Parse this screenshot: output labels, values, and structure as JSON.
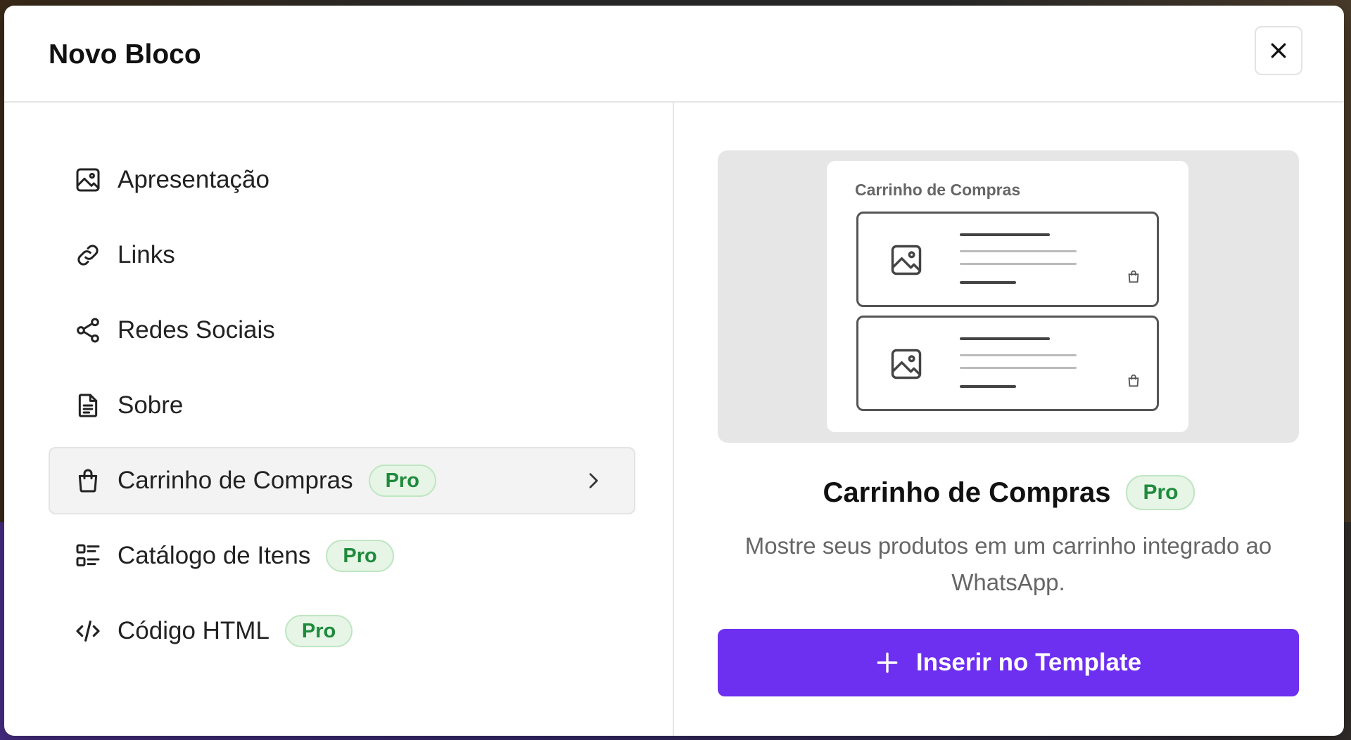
{
  "modal": {
    "title": "Novo Bloco"
  },
  "menu": {
    "items": [
      {
        "label": "Apresentação",
        "icon": "image-icon",
        "pro": false
      },
      {
        "label": "Links",
        "icon": "link-icon",
        "pro": false
      },
      {
        "label": "Redes Sociais",
        "icon": "share-icon",
        "pro": false
      },
      {
        "label": "Sobre",
        "icon": "document-icon",
        "pro": false
      },
      {
        "label": "Carrinho de Compras",
        "icon": "shopping-bag-icon",
        "pro": true,
        "active": true
      },
      {
        "label": "Catálogo de Itens",
        "icon": "catalog-list-icon",
        "pro": true
      },
      {
        "label": "Código HTML",
        "icon": "code-icon",
        "pro": true
      }
    ],
    "pro_label": "Pro"
  },
  "preview": {
    "card_title": "Carrinho de Compras",
    "title": "Carrinho de Compras",
    "pro_label": "Pro",
    "description": "Mostre seus produtos em um carrinho integrado ao WhatsApp.",
    "insert_label": "Inserir no Template"
  },
  "colors": {
    "accent": "#6d2ff0",
    "pro_badge_bg": "#e6f5e6",
    "pro_badge_text": "#1e8a3c"
  }
}
